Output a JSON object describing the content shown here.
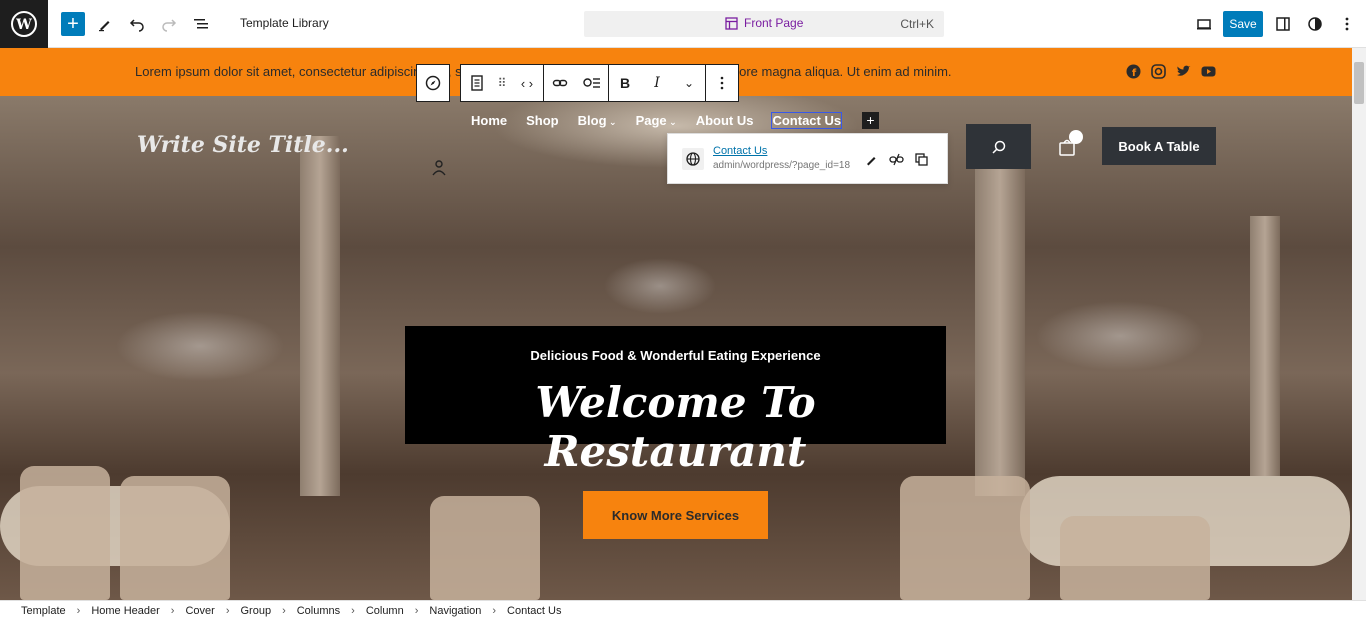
{
  "editor": {
    "document_title": "Template Library",
    "command_bar_label": "Front Page",
    "command_bar_shortcut": "Ctrl+K",
    "save_label": "Save",
    "icons": [
      "wordpress-icon",
      "plus-icon",
      "pen-icon",
      "undo-icon",
      "redo-icon",
      "list-view-icon",
      "desktop-preview-icon",
      "sidebar-toggle-icon",
      "styles-icon",
      "more-options-icon"
    ]
  },
  "site": {
    "top_strip_text": "Lorem ipsum dolor sit amet, consectetur adipiscing elit, sed do eiusmod tempor incididunt ut labore et dolore magna aliqua. Ut enim ad minim.",
    "social_icons": [
      "facebook-icon",
      "instagram-icon",
      "twitter-icon",
      "youtube-icon"
    ],
    "site_title": "Write Site Title...",
    "nav": [
      {
        "label": "Home"
      },
      {
        "label": "Shop"
      },
      {
        "label": "Blog"
      },
      {
        "label": "Page"
      },
      {
        "label": "About Us"
      },
      {
        "label": "Contact Us"
      }
    ],
    "book_button": "Book A Table",
    "hero_subtitle": "Delicious Food & Wonderful Eating Experience",
    "hero_title": "Welcome To Restaurant",
    "cta_label": "Know More Services",
    "accent_color": "#f7830e",
    "dark_color": "#2f3338"
  },
  "link_popover": {
    "title": "Contact Us",
    "url": "admin/wordpress/?page_id=18"
  },
  "breadcrumb": [
    "Template",
    "Home Header",
    "Cover",
    "Group",
    "Columns",
    "Column",
    "Navigation",
    "Contact Us"
  ]
}
